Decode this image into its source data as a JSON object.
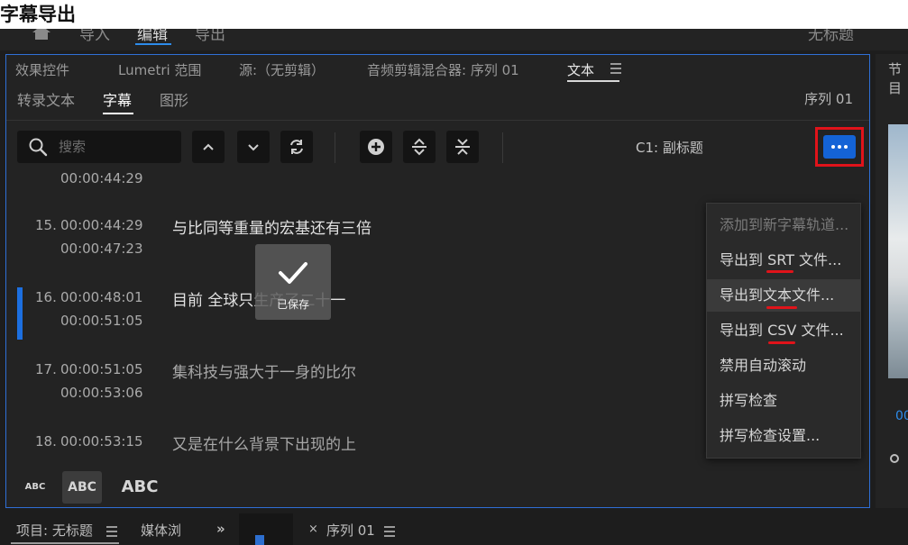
{
  "doc_title": "字幕导出",
  "workspace": {
    "items": [
      "导入",
      "编辑",
      "导出"
    ],
    "active": "编辑",
    "project_title": "无标题"
  },
  "panel_tabs": [
    "效果控件",
    "Lumetri 范围",
    "源:（无剪辑）",
    "音频剪辑混合器: 序列 01",
    "文本"
  ],
  "active_panel_tab": "文本",
  "sub_tabs": [
    "转录文本",
    "字幕",
    "图形"
  ],
  "active_sub_tab": "字幕",
  "sequence_label": "序列 01",
  "search": {
    "placeholder": "搜索",
    "value": ""
  },
  "track_label": "C1: 副标题",
  "captions": {
    "partial_end": "00:00:44:29",
    "items": [
      {
        "num": "15.",
        "start": "00:00:44:29",
        "end": "00:00:47:23",
        "text": "与比同等重量的宏基还有三倍"
      },
      {
        "num": "16.",
        "start": "00:00:48:01",
        "end": "00:00:51:05",
        "text": "目前 全球只生产了二十一"
      },
      {
        "num": "17.",
        "start": "00:00:51:05",
        "end": "00:00:53:06",
        "text": "集科技与强大于一身的比尔"
      },
      {
        "num": "18.",
        "start": "00:00:53:15",
        "end": "",
        "text": "又是在什么背景下出现的上"
      }
    ]
  },
  "toast": {
    "label": "已保存"
  },
  "font_sizes": [
    "ABC",
    "ABC",
    "ABC"
  ],
  "menu": {
    "items": [
      {
        "label": "添加到新字幕轨道...",
        "disabled": true
      },
      {
        "label": "导出到 SRT 文件...",
        "disabled": false
      },
      {
        "label": "导出到文本文件...",
        "disabled": false
      },
      {
        "label": "导出到 CSV 文件...",
        "disabled": false
      },
      {
        "label": "禁用自动滚动",
        "disabled": false
      },
      {
        "label": "拼写检查",
        "disabled": false
      },
      {
        "label": "拼写检查设置...",
        "disabled": false
      }
    ]
  },
  "right_panel": {
    "title": "节目",
    "timecode": "00"
  },
  "bottom_tabs": {
    "project": "项目: 无标题",
    "media": "媒体浏",
    "more": "»",
    "sequence": "序列 01",
    "close": "×"
  },
  "colors": {
    "accent": "#2d8ceb",
    "highlight_box": "#e0131a",
    "marker": "#1c6fe0"
  }
}
